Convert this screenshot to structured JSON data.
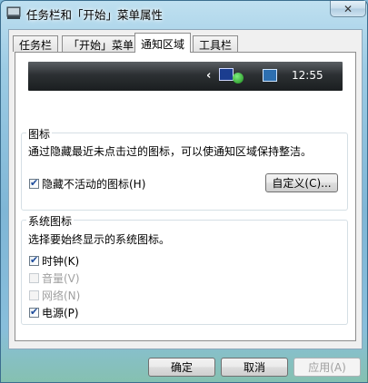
{
  "window": {
    "title": "任务栏和「开始」菜单属性",
    "close_label": "✕"
  },
  "tabs": [
    {
      "label": "任务栏"
    },
    {
      "label": "「开始」菜单"
    },
    {
      "label": "通知区域"
    },
    {
      "label": "工具栏"
    }
  ],
  "tray_preview": {
    "chevron": "‹",
    "icons": [
      "media-center-icon",
      "security-shield-icon",
      "network-icon"
    ],
    "clock": "12:55"
  },
  "icons_group": {
    "title": "图标",
    "description": "通过隐藏最近未点击过的图标，可以使通知区域保持整洁。",
    "hide_inactive": {
      "label": "隐藏不活动的图标(H)",
      "checked": true
    },
    "customize_button": "自定义(C)..."
  },
  "system_icons_group": {
    "title": "系统图标",
    "description": "选择要始终显示的系统图标。",
    "items": [
      {
        "label": "时钟(K)",
        "checked": true,
        "enabled": true
      },
      {
        "label": "音量(V)",
        "checked": false,
        "enabled": false
      },
      {
        "label": "网络(N)",
        "checked": false,
        "enabled": false
      },
      {
        "label": "电源(P)",
        "checked": true,
        "enabled": true
      }
    ]
  },
  "footer": {
    "ok_label": "确定",
    "cancel_label": "取消",
    "apply_label": "应用(A)"
  }
}
